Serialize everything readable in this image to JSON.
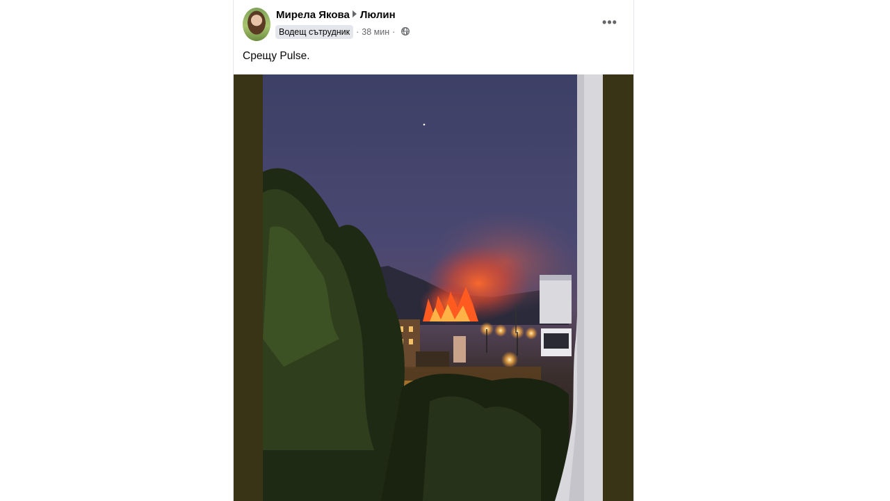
{
  "post": {
    "author": "Мирела Якова",
    "group": "Люлин",
    "badge": "Водещ сътрудник",
    "time": "38 мин",
    "text": "Срещу Pulse.",
    "more_label": "•••"
  },
  "colors": {
    "background": "#ffffff",
    "primary_text": "#050505",
    "secondary_text": "#65676b",
    "badge_bg": "#e4e6eb",
    "photo_frame": "#3a3417",
    "fire": "#ff5a1f"
  },
  "icons": {
    "separator": "caret-right-icon",
    "privacy": "globe-icon",
    "menu": "more-horizontal-icon"
  }
}
